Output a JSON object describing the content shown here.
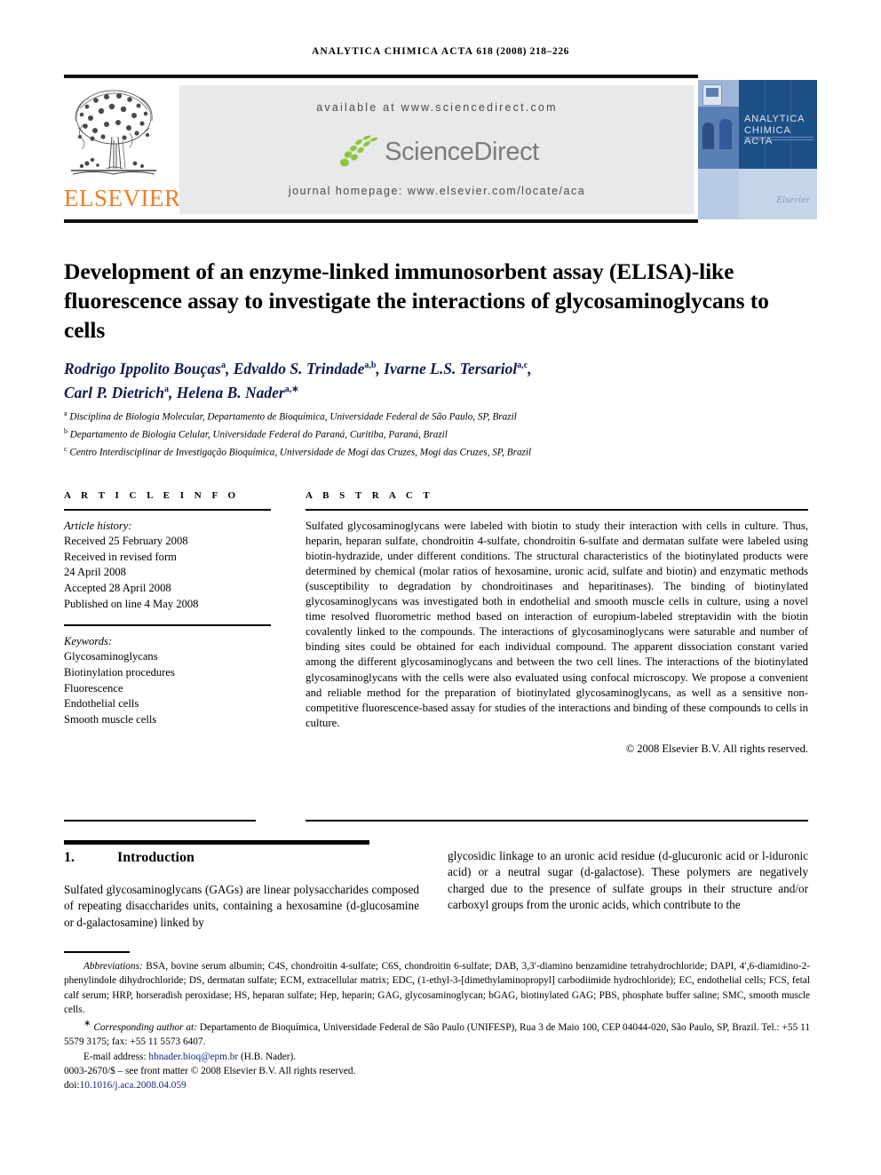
{
  "running_head": {
    "journal": "ANALYTICA CHIMICA ACTA",
    "volume_issue": "618 (2008) 218–226"
  },
  "masthead": {
    "publisher": "ELSEVIER",
    "available_at": "available at www.sciencedirect.com",
    "sciencedirect_wordmark": "ScienceDirect",
    "journal_homepage": "journal homepage: www.elsevier.com/locate/aca",
    "cover_title_line1": "ANALYTICA",
    "cover_title_line2": "CHIMICA ACTA",
    "cover_brand": "Elsevier",
    "accent_orange": "#F07E22",
    "cover_blue": "#1d4f87",
    "banner_grey": "#e8e9ea"
  },
  "article": {
    "title": "Development of an enzyme-linked immunosorbent assay (ELISA)-like fluorescence assay to investigate the interactions of glycosaminoglycans to cells",
    "authors_line1_html": "Rodrigo Ippolito Bouças<sup>a</sup>, Edvaldo S. Trindade<sup>a,b</sup>, Ivarne L.S. Tersariol<sup>a,c</sup>,",
    "authors_line2_html": "Carl P. Dietrich<sup>a</sup>, Helena B. Nader<sup>a,∗</sup>",
    "author_color": "#101c4e",
    "affiliations": [
      "Disciplina de Biologia Molecular, Departamento de Bioquímica, Universidade Federal de São Paulo, SP, Brazil",
      "Departamento de Biologia Celular, Universidade Federal do Paraná, Curitiba, Paraná, Brazil",
      "Centro Interdisciplinar de Investigação Bioquímica, Universidade de Mogi das Cruzes, Mogi das Cruzes, SP, Brazil"
    ],
    "affiliation_marks": [
      "a",
      "b",
      "c"
    ]
  },
  "article_info": {
    "heading": "A R T I C L E   I N F O",
    "history_label": "Article history:",
    "history": [
      "Received 25 February 2008",
      "Received in revised form",
      "24 April 2008",
      "Accepted 28 April 2008",
      "Published on line 4 May 2008"
    ],
    "keywords_label": "Keywords:",
    "keywords": [
      "Glycosaminoglycans",
      "Biotinylation procedures",
      "Fluorescence",
      "Endothelial cells",
      "Smooth muscle cells"
    ]
  },
  "abstract": {
    "heading": "A B S T R A C T",
    "text": "Sulfated glycosaminoglycans were labeled with biotin to study their interaction with cells in culture. Thus, heparin, heparan sulfate, chondroitin 4-sulfate, chondroitin 6-sulfate and dermatan sulfate were labeled using biotin-hydrazide, under different conditions. The structural characteristics of the biotinylated products were determined by chemical (molar ratios of hexosamine, uronic acid, sulfate and biotin) and enzymatic methods (susceptibility to degradation by chondroitinases and heparitinases). The binding of biotinylated glycosaminoglycans was investigated both in endothelial and smooth muscle cells in culture, using a novel time resolved fluorometric method based on interaction of europium-labeled streptavidin with the biotin covalently linked to the compounds. The interactions of glycosaminoglycans were saturable and number of binding sites could be obtained for each individual compound. The apparent dissociation constant varied among the different glycosaminoglycans and between the two cell lines. The interactions of the biotinylated glycosaminoglycans with the cells were also evaluated using confocal microscopy. We propose a convenient and reliable method for the preparation of biotinylated glycosaminoglycans, as well as a sensitive non-competitive fluorescence-based assay for studies of the interactions and binding of these compounds to cells in culture.",
    "copyright": "© 2008 Elsevier B.V. All rights reserved."
  },
  "introduction": {
    "number": "1.",
    "heading": "Introduction",
    "column_left": "Sulfated glycosaminoglycans (GAGs) are linear polysaccharides composed of repeating disaccharides units, containing a hexosamine (d-glucosamine or d-galactosamine) linked by",
    "column_right": "glycosidic linkage to an uronic acid residue (d-glucuronic acid or l-iduronic acid) or a neutral sugar (d-galactose). These polymers are negatively charged due to the presence of sulfate groups in their structure and/or carboxyl groups from the uronic acids, which contribute to the"
  },
  "footnotes": {
    "abbreviations_label": "Abbreviations:",
    "abbreviations_text": "BSA, bovine serum albumin; C4S, chondroitin 4-sulfate; C6S, chondroitin 6-sulfate; DAB, 3,3′-diamino benzamidine tetrahydrochloride; DAPI, 4′,6-diamidino-2-phenylindole dihydrochloride; DS, dermatan sulfate; ECM, extracellular matrix; EDC, (1-ethyl-3-[dimethylaminopropyl] carbodiimide hydrochloride); EC, endothelial cells; FCS, fetal calf serum; HRP, horseradish peroxidase; HS, heparan sulfate; Hep, heparin; GAG, glycosaminoglycan; bGAG, biotinylated GAG; PBS, phosphate buffer saline; SMC, smooth muscle cells.",
    "corresponding_marker": "∗",
    "corresponding_label": "Corresponding author at:",
    "corresponding_text": "Departamento de Bioquímica, Universidade Federal de São Paulo (UNIFESP), Rua 3 de Maio 100, CEP 04044-020, São Paulo, SP, Brazil. Tel.: +55 11 5579 3175; fax: +55 11 5573 6407.",
    "email_label": "E-mail address:",
    "email": "hbnader.bioq@epm.br",
    "email_owner": "(H.B. Nader).",
    "issn_line": "0003-2670/$ – see front matter © 2008 Elsevier B.V. All rights reserved.",
    "doi_label": "doi:",
    "doi": "10.1016/j.aca.2008.04.059",
    "link_color": "#14287a"
  }
}
